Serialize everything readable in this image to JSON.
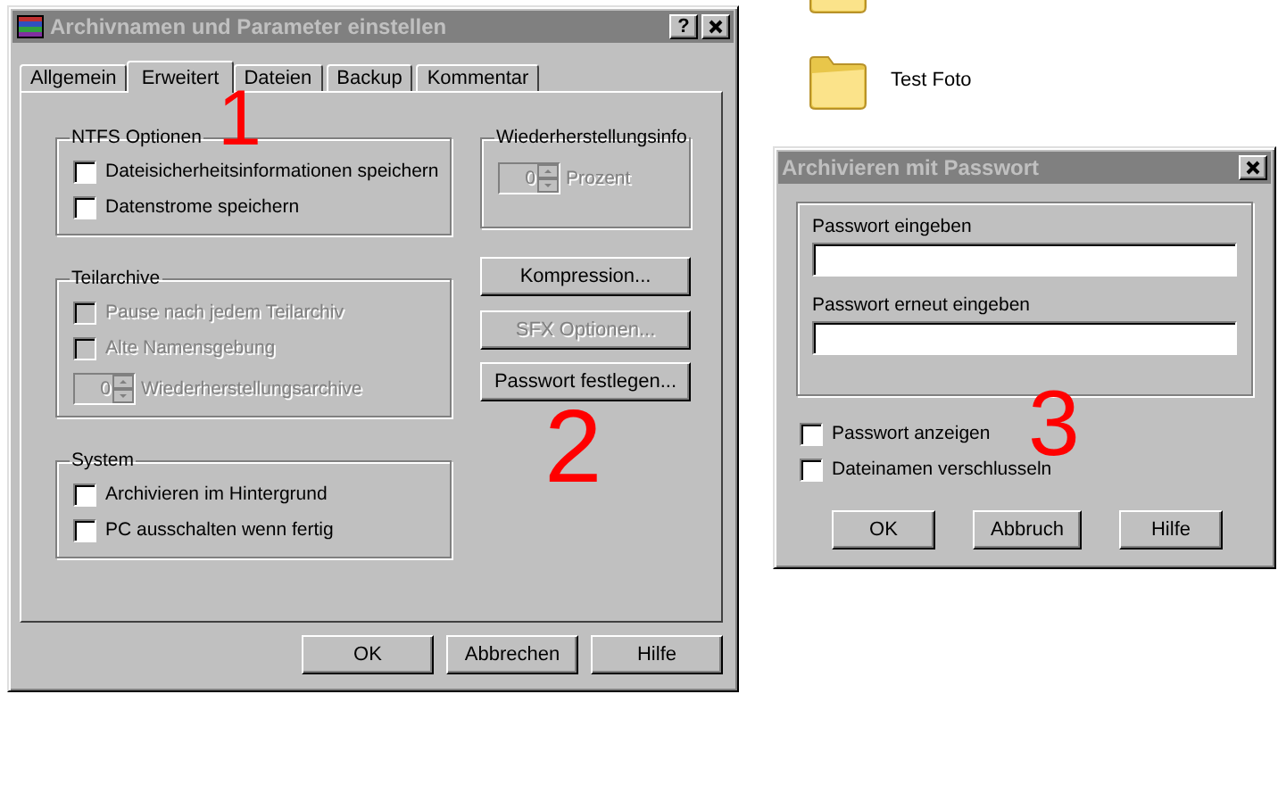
{
  "desktop": {
    "icons": [
      {
        "kind": "folder-bottom"
      },
      {
        "kind": "folder",
        "label": "Test Foto"
      }
    ]
  },
  "main_dialog": {
    "title": "Archivnamen und Parameter einstellen",
    "active": false,
    "help_button": "?",
    "tabs": [
      {
        "label": "Allgemein",
        "selected": false
      },
      {
        "label": "Erweitert",
        "selected": true
      },
      {
        "label": "Dateien",
        "selected": false
      },
      {
        "label": "Backup",
        "selected": false
      },
      {
        "label": "Kommentar",
        "selected": false
      }
    ],
    "left_groups": [
      {
        "title": "NTFS Optionen",
        "items": [
          {
            "kind": "checkbox",
            "label": "Dateisicherheitsinformationen speichern",
            "checked": false,
            "disabled": false
          },
          {
            "kind": "checkbox",
            "label": "Datenstrome speichern",
            "checked": false,
            "disabled": false
          }
        ]
      },
      {
        "title": "Teilarchive",
        "items": [
          {
            "kind": "checkbox",
            "label": "Pause nach jedem Teilarchiv",
            "checked": false,
            "disabled": true
          },
          {
            "kind": "checkbox",
            "label": "Alte Namensgebung",
            "checked": false,
            "disabled": true
          },
          {
            "kind": "spinner",
            "value": "0",
            "label": "Wiederherstellungsarchive",
            "disabled": true
          }
        ]
      },
      {
        "title": "System",
        "items": [
          {
            "kind": "checkbox",
            "label": "Archivieren im Hintergrund",
            "checked": false,
            "disabled": false
          },
          {
            "kind": "checkbox",
            "label": "PC ausschalten wenn fertig",
            "checked": false,
            "disabled": false
          }
        ]
      }
    ],
    "right_group": {
      "title": "Wiederherstellungsinfo",
      "items": [
        {
          "kind": "spinner",
          "value": "0",
          "label": "Prozent",
          "disabled": true
        }
      ]
    },
    "side_buttons": [
      {
        "label": "Kompression...",
        "disabled": false
      },
      {
        "label": "SFX Optionen...",
        "disabled": true
      },
      {
        "label": "Passwort festlegen...",
        "disabled": false
      }
    ],
    "buttons": [
      "OK",
      "Abbrechen",
      "Hilfe"
    ]
  },
  "password_dialog": {
    "title": "Archivieren mit Passwort",
    "active": false,
    "fields": [
      {
        "label": "Passwort eingeben"
      },
      {
        "label": "Passwort erneut eingeben"
      }
    ],
    "options": [
      {
        "kind": "checkbox",
        "label": "Passwort anzeigen",
        "checked": false,
        "disabled": false
      },
      {
        "kind": "checkbox",
        "label": "Dateinamen verschlusseln",
        "checked": false,
        "disabled": false
      }
    ],
    "buttons": [
      "OK",
      "Abbruch",
      "Hilfe"
    ]
  },
  "annotations": [
    {
      "text": "1"
    },
    {
      "text": "2"
    },
    {
      "text": "3"
    }
  ]
}
